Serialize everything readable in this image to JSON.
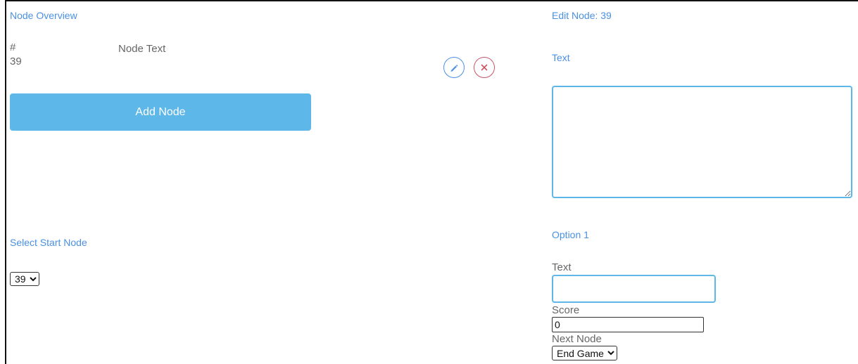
{
  "overview": {
    "title": "Node Overview",
    "col_id": "#",
    "col_text": "Node Text",
    "row_id": "39",
    "row_text": "",
    "add_node_label": "Add Node",
    "select_start_label": "Select Start Node",
    "start_node_value": "39"
  },
  "editor": {
    "title": "Edit Node: 39",
    "text_label": "Text",
    "text_value": "",
    "option_title": "Option 1",
    "option_text_label": "Text",
    "option_text_value": "",
    "score_label": "Score",
    "score_value": "0",
    "next_node_label": "Next Node",
    "next_node_value": "End Game"
  },
  "colors": {
    "accent": "#4a90e2",
    "button": "#5db7e8",
    "delete": "#cc5566"
  }
}
